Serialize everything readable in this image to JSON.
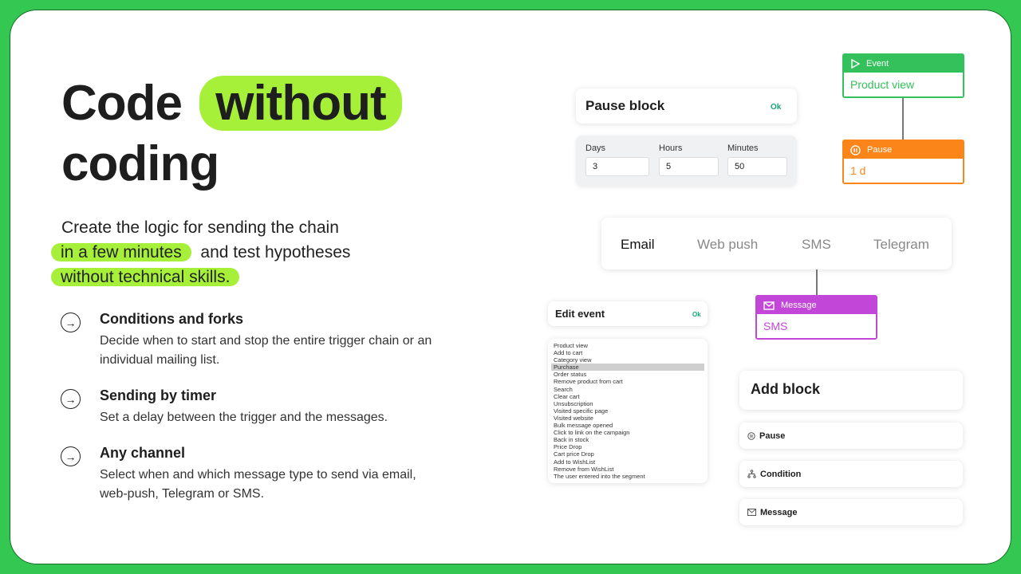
{
  "hero": {
    "line1": "Code",
    "highlight": "without",
    "line2": "coding"
  },
  "lead": {
    "part1": "Create the logic for sending the chain",
    "hl1": "in a few minutes",
    "part2": "and test hypotheses",
    "hl2": "without technical skills."
  },
  "features": [
    {
      "icon": "arrow-right-circle-icon",
      "title": "Conditions and forks",
      "desc": "Decide when to start and stop the entire trigger chain or an individual mailing list."
    },
    {
      "icon": "arrow-right-circle-icon",
      "title": "Sending by timer",
      "desc": "Set a delay between the trigger and the messages."
    },
    {
      "icon": "arrow-right-circle-icon",
      "title": "Any channel",
      "desc": "Select when and which message type to send via email, web-push, Telegram or SMS."
    }
  ],
  "pause_block": {
    "title": "Pause block",
    "ok": "Ok",
    "days_label": "Days",
    "days": "3",
    "hours_label": "Hours",
    "hours": "5",
    "minutes_label": "Minutes",
    "minutes": "50"
  },
  "nodes": {
    "event": {
      "label": "Event",
      "value": "Product view",
      "color": "#34c05a"
    },
    "pause": {
      "label": "Pause",
      "value": "1 d",
      "color": "#fb8519"
    },
    "message": {
      "label": "Message",
      "value": "SMS",
      "color": "#c247d8"
    }
  },
  "channels": {
    "tabs": [
      "Email",
      "Web push",
      "SMS",
      "Telegram"
    ],
    "active": "Email"
  },
  "edit_event": {
    "title": "Edit event",
    "ok": "Ok",
    "selected": "Purchase",
    "items": [
      "Product view",
      "Add to cart",
      "Category view",
      "Purchase",
      "Order status",
      "Remove product from cart",
      "Search",
      "Clear cart",
      "Unsubscription",
      "Visited specific page",
      "Visited website",
      "Bulk message opened",
      "Click to link on the campaign",
      "Back in stock",
      "Price Drop",
      "Cart price Drop",
      "Add to WishList",
      "Remove from WishList",
      "The user entered into the segment"
    ]
  },
  "add_block": {
    "title": "Add block",
    "options": [
      {
        "label": "Pause",
        "icon": "pause-icon"
      },
      {
        "label": "Condition",
        "icon": "fork-icon"
      },
      {
        "label": "Message",
        "icon": "mail-icon"
      }
    ]
  }
}
